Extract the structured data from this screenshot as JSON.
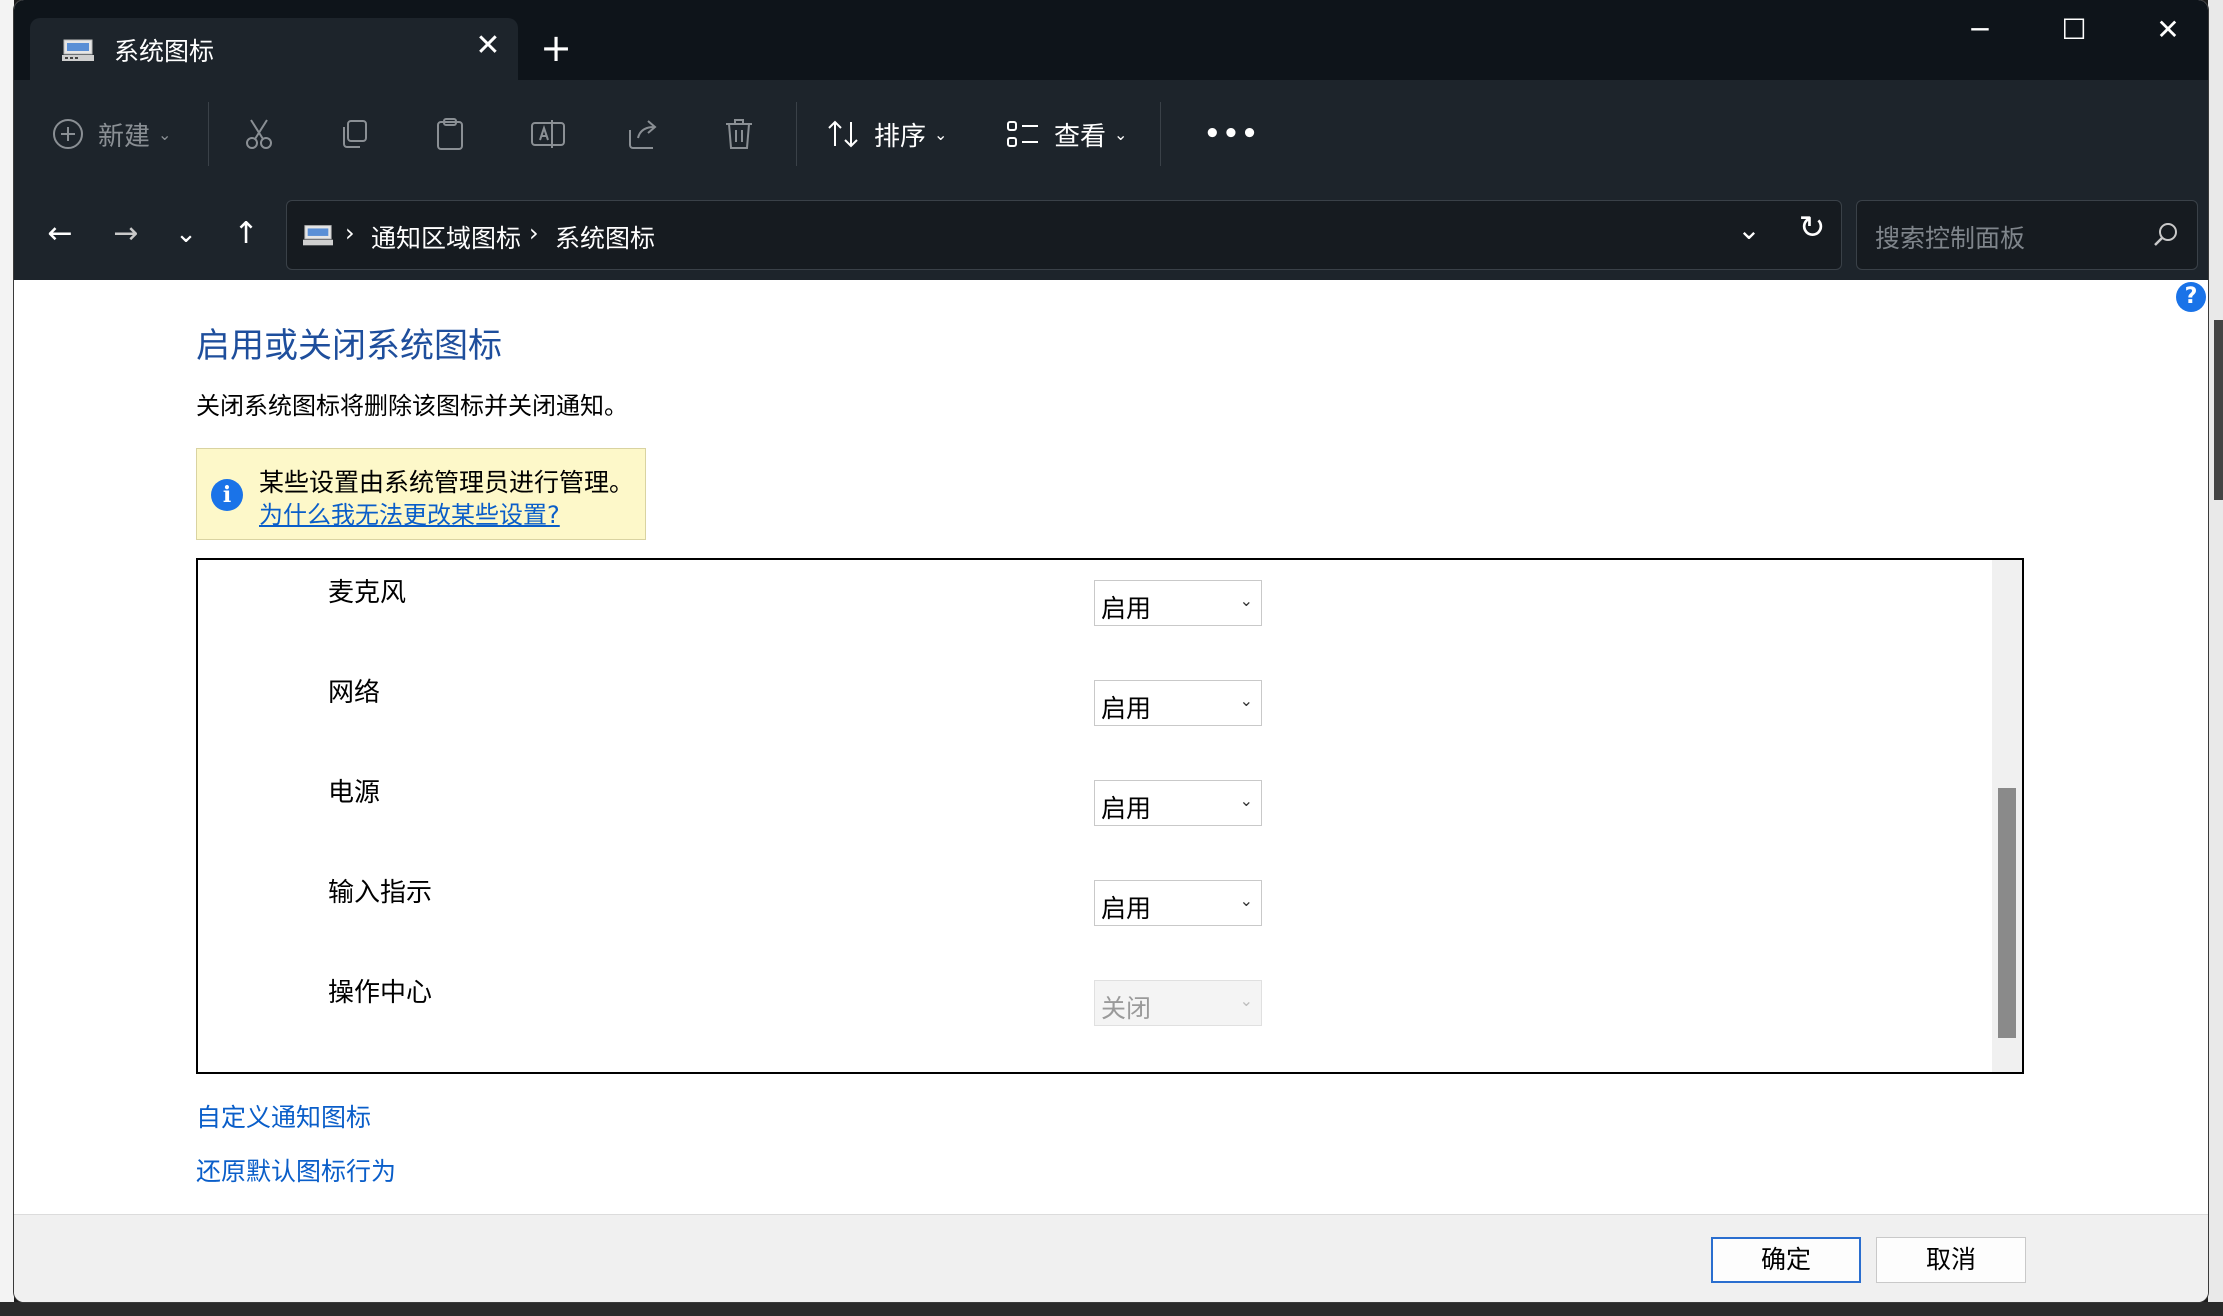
{
  "window": {
    "tab_title": "系统图标",
    "tab_close": "✕",
    "new_tab": "+",
    "minimize": "─",
    "maximize": "☐",
    "close": "✕"
  },
  "toolbar": {
    "new_label": "新建",
    "sort_label": "排序",
    "view_label": "查看",
    "more_label": "•••"
  },
  "address": {
    "crumbs": [
      "通知区域图标",
      "系统图标"
    ],
    "separator": "›",
    "search_placeholder": "搜索控制面板"
  },
  "content": {
    "help": "?",
    "title": "启用或关闭系统图标",
    "description": "关闭系统图标将删除该图标并关闭通知。",
    "notice_text": "某些设置由系统管理员进行管理。",
    "notice_link": "为什么我无法更改某些设置?",
    "rows": [
      {
        "label": "麦克风",
        "value": "启用",
        "enabled": true
      },
      {
        "label": "网络",
        "value": "启用",
        "enabled": true
      },
      {
        "label": "电源",
        "value": "启用",
        "enabled": true
      },
      {
        "label": "输入指示",
        "value": "启用",
        "enabled": true
      },
      {
        "label": "操作中心",
        "value": "关闭",
        "enabled": false
      }
    ],
    "link_customize": "自定义通知图标",
    "link_restore": "还原默认图标行为"
  },
  "footer": {
    "ok_label": "确定",
    "cancel_label": "取消"
  },
  "colors": {
    "title_blue": "#1e4e9c",
    "link_blue": "#0a5ec9",
    "notice_bg": "#fdf8c9",
    "titlebar_bg": "#0e141a",
    "toolbar_bg": "#1d242b"
  }
}
